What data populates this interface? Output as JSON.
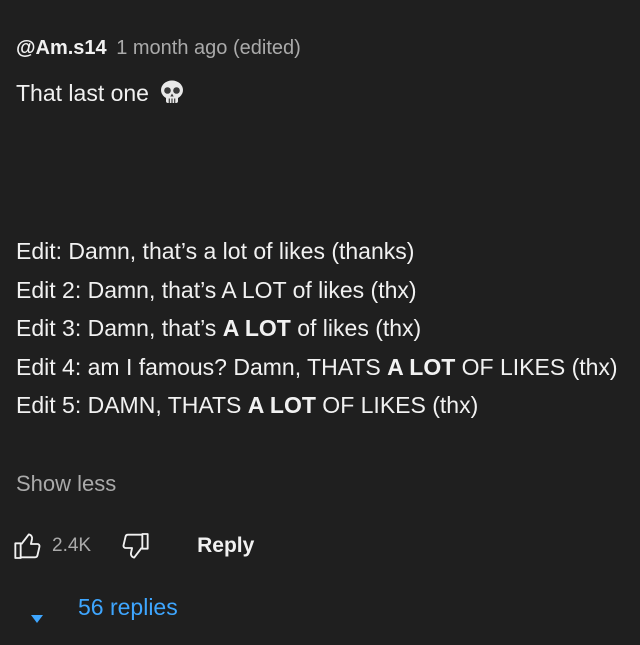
{
  "comment": {
    "author": "@Am.s14",
    "timestamp": "1 month ago (edited)",
    "text_first_line": "That last one",
    "emoji_icon": "skull-icon",
    "edits": [
      {
        "label": "Edit:",
        "text": "Damn, that’s a lot of likes (thanks)"
      },
      {
        "label": "Edit 2:",
        "text": "Damn, that’s A LOT of likes (thx)"
      },
      {
        "label": "Edit 3:",
        "pre": "Damn, that’s ",
        "bold": "A LOT",
        "post": " of likes (thx)"
      },
      {
        "label": "Edit 4:",
        "pre": "am I famous? Damn, THATS ",
        "bold": "A LOT",
        "post": " OF LIKES (thx)"
      },
      {
        "label": "Edit 5:",
        "pre": "DAMN, THATS ",
        "bold": "A LOT",
        "post": " OF LIKES (thx)"
      }
    ],
    "show_less_label": "Show less"
  },
  "actions": {
    "like_count": "2.4K",
    "reply_label": "Reply",
    "like_icon": "thumbs-up-icon",
    "dislike_icon": "thumbs-down-icon"
  },
  "replies": {
    "label": "56 replies",
    "icon": "caret-down-icon",
    "accent_color": "#3ea6ff"
  },
  "colors": {
    "background": "#1f1f1f",
    "text": "#f1f1f1",
    "secondary": "#aaaaaa"
  }
}
